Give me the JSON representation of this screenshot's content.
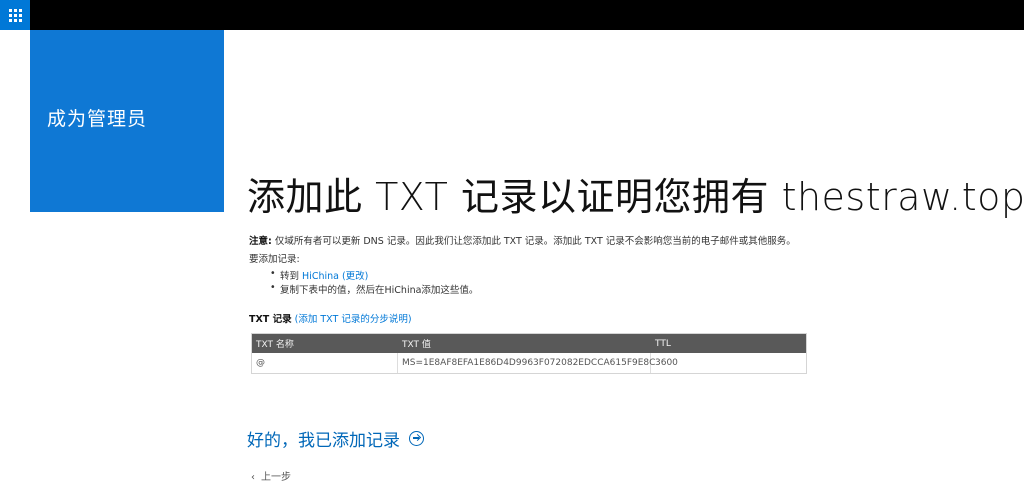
{
  "topbar": {
    "app_launcher_icon": "waffle-grid-icon",
    "accent": "#0078d7"
  },
  "tile": {
    "label": "成为管理员",
    "color": "#0f78d4"
  },
  "heading": {
    "part1": "添加此",
    "part2": " TXT ",
    "part3": "记录以证明您拥有",
    "domain": " thestraw.top"
  },
  "note": {
    "label": "注意:",
    "text": " 仅域所有者可以更新 DNS 记录。因此我们让您添加此 TXT 记录。添加此 TXT 记录不会影响您当前的电子邮件或其他服务。"
  },
  "add_record_intro": "要添加记录:",
  "steps": [
    {
      "prefix": "转到 ",
      "link": "HiChina (更改)"
    },
    {
      "prefix": "复制下表中的值，然后在HiChina添加这些值。",
      "link": ""
    }
  ],
  "txt_section": {
    "label": "TXT 记录",
    "link": "(添加 TXT 记录的分步说明)"
  },
  "table": {
    "headers": [
      "TXT 名称",
      "TXT 值",
      "TTL"
    ],
    "rows": [
      [
        "@",
        "MS=1E8AF8EFA1E86D4D9963F072082EDCCA615F9E8C",
        "3600"
      ]
    ]
  },
  "actions": {
    "done_label": "好的，我已添加记录",
    "back_label": "上一步"
  }
}
